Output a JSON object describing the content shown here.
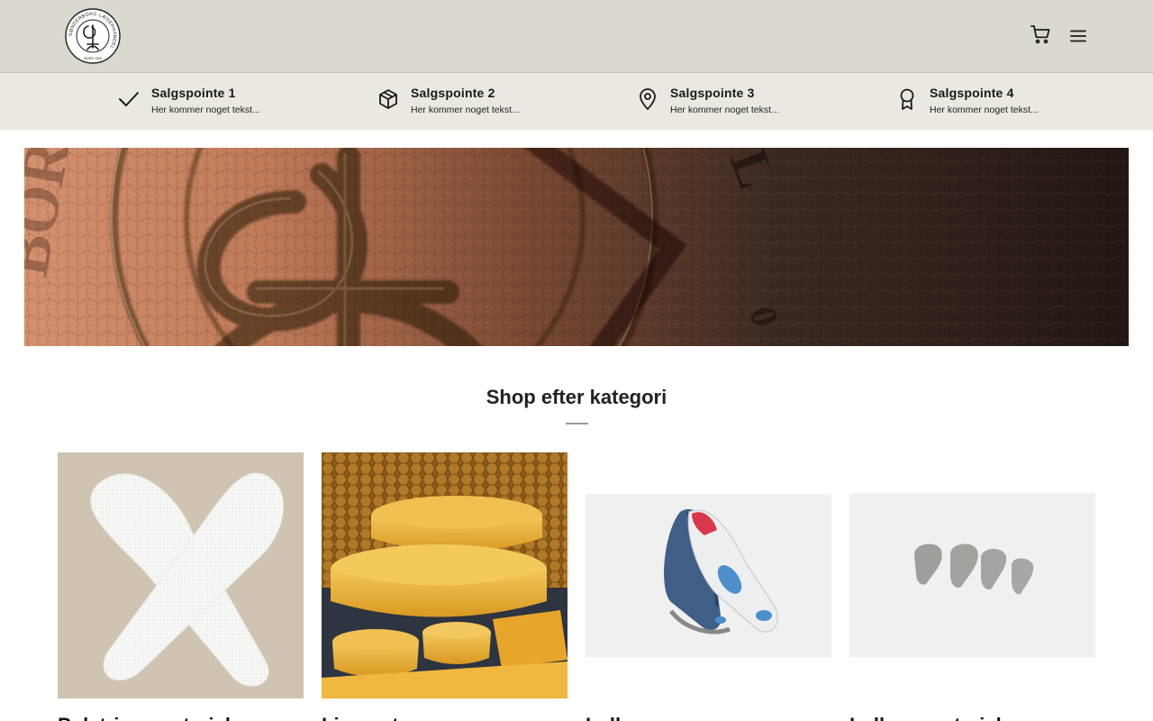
{
  "header": {
    "logo_text": "SØNDERBORG LÆDERHANDEL",
    "logo_since": "SIDEN 1920",
    "cart_icon": "cart-icon",
    "menu_icon": "menu-icon"
  },
  "usps": [
    {
      "icon": "check-icon",
      "title": "Salgspointe 1",
      "text": "Her kommer noget tekst..."
    },
    {
      "icon": "box-icon",
      "title": "Salgspointe 2",
      "text": "Her kommer noget tekst..."
    },
    {
      "icon": "map-pin-icon",
      "title": "Salgspointe 3",
      "text": "Her kommer noget tekst..."
    },
    {
      "icon": "award-icon",
      "title": "Salgspointe 4",
      "text": "Her kommer noget tekst..."
    }
  ],
  "hero": {
    "emboss_letters_left": "BORG",
    "emboss_letters_right": "L",
    "emboss_digits": "0"
  },
  "categories_section": {
    "title": "Shop efter kategori",
    "items": [
      {
        "name": "Polstringsmaterialer",
        "image": "white insoles"
      },
      {
        "name": "Lim og tape",
        "image": "beeswax blocks"
      },
      {
        "name": "Indlæg",
        "image": "blue sport insoles"
      },
      {
        "name": "Indlægsmaterialer",
        "image": "grey pads"
      }
    ]
  },
  "colors": {
    "header_bg": "#dbd9cf",
    "usp_bg": "#eae8e1",
    "text": "#1a1a1a",
    "leather_light": "#c98463",
    "leather_dark": "#2a1c16"
  }
}
